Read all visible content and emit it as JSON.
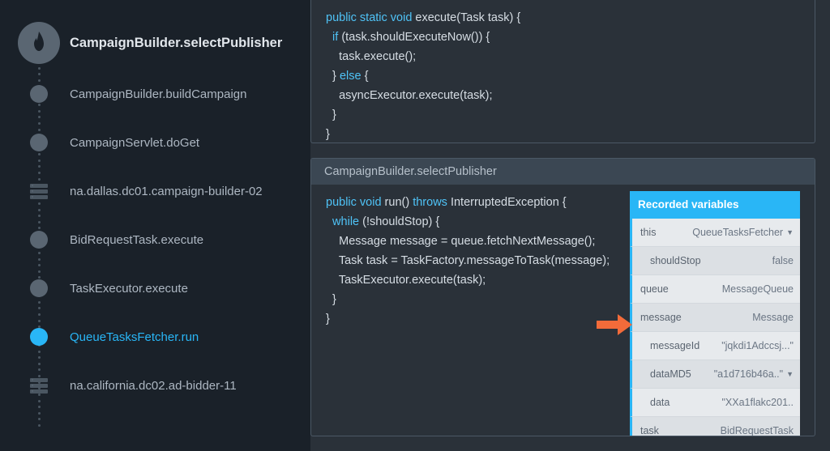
{
  "stack": {
    "title": "CampaignBuilder.selectPublisher",
    "items": [
      {
        "label": "CampaignBuilder.buildCampaign",
        "type": "dot",
        "active": false
      },
      {
        "label": "CampaignServlet.doGet",
        "type": "dot",
        "active": false
      },
      {
        "label": "na.dallas.dc01.campaign-builder-02",
        "type": "server",
        "active": false
      },
      {
        "label": "BidRequestTask.execute",
        "type": "dot",
        "active": false
      },
      {
        "label": "TaskExecutor.execute",
        "type": "dot",
        "active": false
      },
      {
        "label": "QueueTasksFetcher.run",
        "type": "dot",
        "active": true
      },
      {
        "label": "na.california.dc02.ad-bidder-11",
        "type": "server",
        "active": false
      }
    ]
  },
  "top_panel": {
    "code": {
      "line1_pre": "public static void ",
      "line1_post": "execute(Task task) {",
      "line2_pre": "  if ",
      "line2_post": "(task.shouldExecuteNow()) {",
      "line3": "    task.execute();",
      "line4_pre": "  } ",
      "line4_kw": "else ",
      "line4_post": "{",
      "line5": "    asyncExecutor.execute(task);",
      "line6": "  }",
      "line7": "}"
    }
  },
  "bottom_panel": {
    "title": "CampaignBuilder.selectPublisher",
    "code": {
      "l1a": "public void ",
      "l1b": "run() ",
      "l1c": "throws ",
      "l1d": "InterruptedException {",
      "l2a": "  while ",
      "l2b": "(!shouldStop) {",
      "l3": "    Message message = queue.fetchNextMessage();",
      "l4": "    Task task = TaskFactory.messageToTask(message);",
      "l5": "    TaskExecutor.execute(task);",
      "l6": "  }",
      "l7": "}"
    },
    "vars_header": "Recorded variables",
    "vars": [
      {
        "name": "this",
        "value": "QueueTasksFetcher",
        "indent": false,
        "chev": true
      },
      {
        "name": "shouldStop",
        "value": "false",
        "indent": true,
        "chev": false
      },
      {
        "name": "queue",
        "value": "MessageQueue",
        "indent": false,
        "chev": false
      },
      {
        "name": "message",
        "value": "Message",
        "indent": false,
        "chev": false
      },
      {
        "name": "messageId",
        "value": "\"jqkdi1Adccsj...\"",
        "indent": true,
        "chev": false
      },
      {
        "name": "dataMD5",
        "value": "\"a1d716b46a..\"",
        "indent": true,
        "chev": true
      },
      {
        "name": "data",
        "value": "\"XXa1flakc201..",
        "indent": true,
        "chev": false
      },
      {
        "name": "task",
        "value": "BidRequestTask",
        "indent": false,
        "chev": false
      }
    ]
  }
}
